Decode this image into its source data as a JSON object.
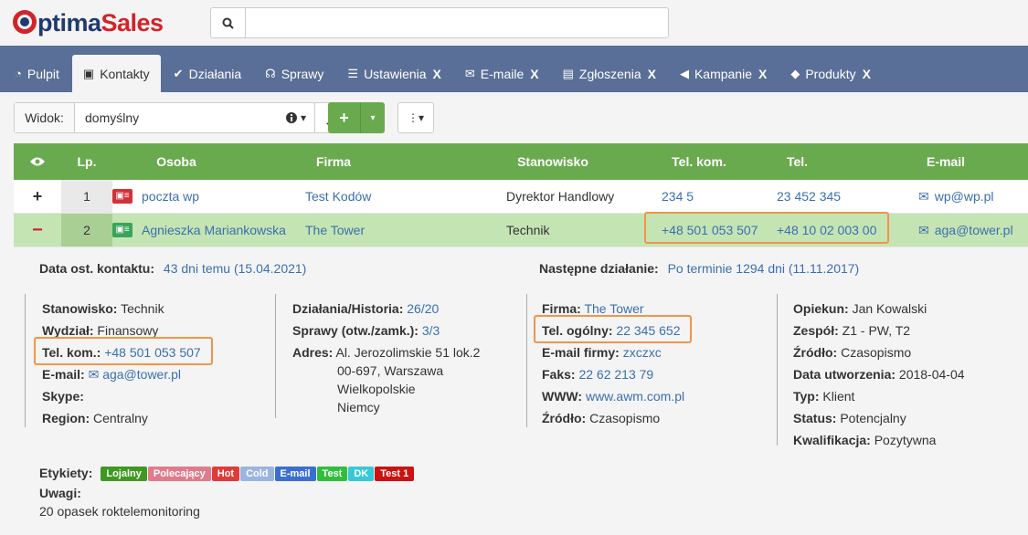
{
  "app": {
    "logo_o": "O",
    "logo_optima": "ptima",
    "logo_sales": "Sales"
  },
  "search": {
    "placeholder": "",
    "value": ""
  },
  "nav": {
    "tabs": [
      {
        "label": "Pulpit",
        "icon": "dashboard-icon",
        "glyph": "◔",
        "closable": false,
        "active": false
      },
      {
        "label": "Kontakty",
        "icon": "contact-card-icon",
        "glyph": "▣",
        "closable": false,
        "active": true
      },
      {
        "label": "Działania",
        "icon": "check-circle-icon",
        "glyph": "✔",
        "closable": false,
        "active": false
      },
      {
        "label": "Sprawy",
        "icon": "handshake-icon",
        "glyph": "☊",
        "closable": false,
        "active": false
      },
      {
        "label": "Ustawienia",
        "icon": "sliders-icon",
        "glyph": "☰",
        "closable": true,
        "active": false
      },
      {
        "label": "E-maile",
        "icon": "envelope-icon",
        "glyph": "✉",
        "closable": true,
        "active": false
      },
      {
        "label": "Zgłoszenia",
        "icon": "briefcase-icon",
        "glyph": "▤",
        "closable": true,
        "active": false
      },
      {
        "label": "Kampanie",
        "icon": "bullhorn-icon",
        "glyph": "◀",
        "closable": true,
        "active": false
      },
      {
        "label": "Produkty",
        "icon": "cube-icon",
        "glyph": "◆",
        "closable": true,
        "active": false
      }
    ],
    "close_label": "X"
  },
  "toolbar": {
    "view_label": "Widok:",
    "view_value": "domyślny",
    "add_symbol": "+",
    "caret": "▾",
    "more_symbol": "⋮▾"
  },
  "table": {
    "headers": {
      "visibility": "👁",
      "lp": "Lp.",
      "person": "Osoba",
      "company": "Firma",
      "position": "Stanowisko",
      "mobile": "Tel. kom.",
      "phone": "Tel.",
      "email": "E-mail"
    },
    "rows": [
      {
        "toggle": "+",
        "lp": "1",
        "person": "poczta wp",
        "company": "Test Kodów",
        "position": "Dyrektor Handlowy",
        "mobile": "234 5",
        "phone": "23 452 345",
        "email": "wp@wp.pl",
        "icon_color": "#d2323a"
      },
      {
        "toggle": "−",
        "lp": "2",
        "person": "Agnieszka Mariankowska",
        "company": "The Tower",
        "position": "Technik",
        "mobile": "+48 501 053 507",
        "phone": "+48 10 02 003 00",
        "email": "aga@tower.pl",
        "icon_color": "#3aa35a"
      }
    ]
  },
  "details": {
    "last_contact_label": "Data ost. kontaktu:",
    "last_contact_value": "43 dni temu (15.04.2021)",
    "next_action_label": "Następne działanie:",
    "next_action_value": "Po terminie 1294 dni (11.11.2017)",
    "col1": {
      "position_label": "Stanowisko:",
      "position_value": "Technik",
      "department_label": "Wydział:",
      "department_value": "Finansowy",
      "mobile_label": "Tel. kom.:",
      "mobile_value": "+48 501 053 507",
      "email_label": "E-mail:",
      "email_value": "aga@tower.pl",
      "skype_label": "Skype:",
      "region_label": "Region:",
      "region_value": "Centralny"
    },
    "col2": {
      "actions_label": "Działania/Historia:",
      "actions_value": "26/20",
      "cases_label": "Sprawy (otw./zamk.):",
      "cases_value": "3/3",
      "address_label": "Adres:",
      "address_line1": "Al. Jerozolimskie 51 lok.2",
      "address_line2": "00-697, Warszawa",
      "address_line3": "Wielkopolskie",
      "address_line4": "Niemcy"
    },
    "col3": {
      "company_label": "Firma:",
      "company_value": "The Tower",
      "general_phone_label": "Tel. ogólny:",
      "general_phone_value": "22 345 652",
      "company_email_label": "E-mail firmy:",
      "company_email_value": "zxczxc",
      "fax_label": "Faks:",
      "fax_value": "22 62 213 79",
      "www_label": "WWW:",
      "www_value": "www.awm.com.pl",
      "source_label": "Źródło:",
      "source_value": "Czasopismo"
    },
    "col4": {
      "owner_label": "Opiekun:",
      "owner_value": "Jan Kowalski",
      "team_label": "Zespół:",
      "team_value": "Z1 - PW, T2",
      "source_label": "Źródło:",
      "source_value": "Czasopismo",
      "created_label": "Data utworzenia:",
      "created_value": "2018-04-04",
      "type_label": "Typ:",
      "type_value": "Klient",
      "status_label": "Status:",
      "status_value": "Potencjalny",
      "qualification_label": "Kwalifikacja:",
      "qualification_value": "Pozytywna"
    },
    "tags_label": "Etykiety:",
    "tags": [
      {
        "label": "Lojalny",
        "color": "#3e9a1f"
      },
      {
        "label": "Polecający",
        "color": "#e07b8c"
      },
      {
        "label": "Hot",
        "color": "#e03a3a"
      },
      {
        "label": "Cold",
        "color": "#9ab5e0"
      },
      {
        "label": "E-mail",
        "color": "#3a6fd0"
      },
      {
        "label": "Test",
        "color": "#2fbf3a"
      },
      {
        "label": "DK",
        "color": "#39c8d8"
      },
      {
        "label": "Test 1",
        "color": "#cc1111"
      }
    ],
    "notes_label": "Uwagi:",
    "notes_value": "20 opasek roktelemonitoring"
  },
  "colors": {
    "accent_green": "#6aaa4f",
    "nav_bg": "#5a6f97",
    "highlight": "#f0954a",
    "link": "#3a6fb0"
  }
}
